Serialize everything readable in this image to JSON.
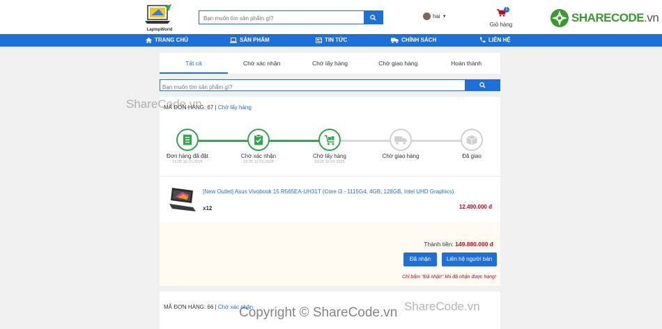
{
  "header": {
    "logo_text": "LaptopWorld",
    "search_placeholder": "Bạn muốn tìm sản phẩm gì?",
    "user_name": "hai",
    "cart_count": "1",
    "cart_label": "Giỏ hàng",
    "brand_main": "SHARECODE",
    "brand_suffix": ".vn"
  },
  "nav": {
    "items": [
      {
        "label": "TRANG CHỦ",
        "icon": "home-icon"
      },
      {
        "label": "SẢN PHẨM",
        "icon": "laptop-icon"
      },
      {
        "label": "TIN TỨC",
        "icon": "news-icon"
      },
      {
        "label": "CHÍNH SÁCH",
        "icon": "truck-icon"
      },
      {
        "label": "LIÊN HỆ",
        "icon": "phone-icon"
      }
    ]
  },
  "tabs": [
    {
      "label": "Tất cả",
      "active": true
    },
    {
      "label": "Chờ xác nhận"
    },
    {
      "label": "Chờ lấy hàng"
    },
    {
      "label": "Chờ giao hàng"
    },
    {
      "label": "Hoàn thành"
    }
  ],
  "order_search": {
    "placeholder": "Bạn muốn tìm sản phẩm gì?"
  },
  "order": {
    "code_label": "MÃ ĐƠN HÀNG: 67",
    "separator": "|",
    "status": "Chờ lấy hàng",
    "steps": [
      {
        "label": "Đơn hàng đã đặt",
        "date": "15:05 12-01-2025",
        "done": true,
        "icon": "receipt-icon"
      },
      {
        "label": "Chờ xác nhận",
        "date": "15:25 12-01-2025",
        "done": true,
        "icon": "clipboard-check-icon"
      },
      {
        "label": "Chờ lấy hàng",
        "date": "23:01 12-02-2025",
        "done": true,
        "icon": "cart-icon"
      },
      {
        "label": "Chờ giao hàng",
        "date": "",
        "done": false,
        "icon": "truck-icon"
      },
      {
        "label": "Đã giao",
        "date": "",
        "done": false,
        "icon": "box-icon"
      }
    ],
    "product_name": "[New Outlet] Asus Vivobook 15 R565EA-UH31T (Core i3 - 1115G4, 4GB, 128GB, Intel UHD Graphics)",
    "quantity": "x12",
    "price": "12.490.000 đ",
    "total_label": "Thành tiền:",
    "total_value": "149.880.000 đ",
    "received_button": "Đã nhận",
    "contact_button": "Liên hệ người bán",
    "note": "Chỉ bấm \"Đã nhận\" khi đã nhận được hàng!"
  },
  "order2": {
    "code_label": "MÃ ĐƠN HÀNG: 66",
    "separator": "|",
    "status": "Chờ xác nhận"
  },
  "watermarks": {
    "wm1": "ShareCode.vn",
    "wm2": "ShareCode.vn",
    "copyright": "Copyright © ShareCode.vn"
  },
  "colors": {
    "primary": "#1e6fd9",
    "success": "#2ea84a",
    "price": "#d0021b"
  }
}
